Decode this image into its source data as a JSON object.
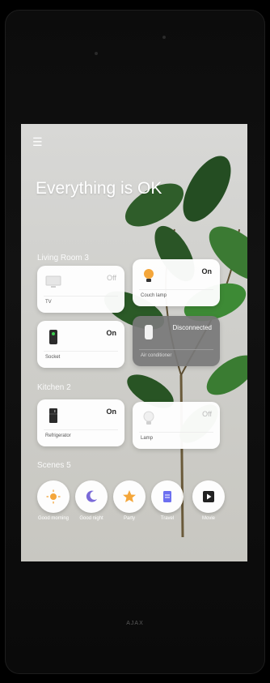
{
  "device": {
    "brand": "AJAX"
  },
  "header": {
    "title": "Everything is OK"
  },
  "sections": {
    "living": "Living Room 3",
    "kitchen": "Kitchen 2",
    "scenes": "Scenes 5"
  },
  "tiles": [
    {
      "name": "TV",
      "state": "Off"
    },
    {
      "name": "Couch lamp",
      "state": "On"
    },
    {
      "name": "Socket",
      "state": "On"
    },
    {
      "name": "Air conditioner",
      "state": "Disconnected"
    },
    {
      "name": "Refrigerator",
      "state": "On"
    },
    {
      "name": "Lamp",
      "state": "Off"
    }
  ],
  "scenes": [
    {
      "label": "Good morning",
      "icon": "sun-icon"
    },
    {
      "label": "Good night",
      "icon": "moon-icon"
    },
    {
      "label": "Party",
      "icon": "star-icon"
    },
    {
      "label": "Travel",
      "icon": "document-icon"
    },
    {
      "label": "Movie",
      "icon": "play-icon"
    }
  ],
  "colors": {
    "accent": "#f4a63a",
    "moon": "#7a6ad8",
    "doc": "#6c6ff0",
    "play": "#222222"
  }
}
